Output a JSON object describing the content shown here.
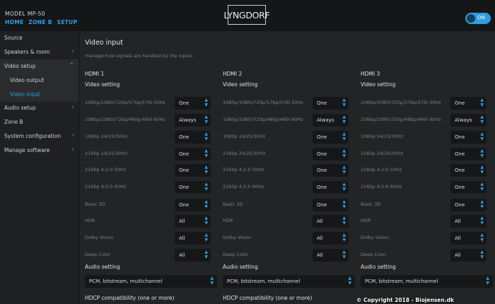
{
  "header": {
    "model": "MODEL MP-50",
    "breadcrumb": [
      "HOME",
      "ZONE B",
      "SETUP"
    ],
    "logo": "LYNGDORF",
    "power_toggle": "ON",
    "accent_color": "#2f9ee0"
  },
  "sidebar": {
    "items": [
      {
        "label": "Source",
        "chevron": false
      },
      {
        "label": "Speakers & room",
        "chevron": true
      },
      {
        "label": "Video setup",
        "chevron": true,
        "open": true
      },
      {
        "label": "Video output",
        "sub": true
      },
      {
        "label": "Video input",
        "sub": true,
        "active": true
      },
      {
        "label": "Audio setup",
        "chevron": true
      },
      {
        "label": "Zone B",
        "chevron": false
      },
      {
        "label": "System configuration",
        "chevron": true
      },
      {
        "label": "Manage software",
        "chevron": true
      }
    ]
  },
  "main": {
    "title": "Video input",
    "description": "manage how signals are handled by the inputs",
    "columns": [
      {
        "heading": "HDMI 1",
        "video_setting_label": "Video setting",
        "rows": [
          {
            "label": "1080p/1080i/720p/576p/576i 50Hz",
            "value": "One"
          },
          {
            "label": "1080p/1080i/720p/480p/480i 60Hz",
            "value": "Always"
          },
          {
            "label": "1080p 24/25/30Hz",
            "value": "One"
          },
          {
            "label": "2160p 24/25/30Hz",
            "value": "One"
          },
          {
            "label": "2160p 4:2:0 50Hz",
            "value": "One"
          },
          {
            "label": "2160p 4:2:0 60Hz",
            "value": "One"
          },
          {
            "label": "Basic 3D",
            "value": "One"
          },
          {
            "label": "HDR",
            "value": "All"
          },
          {
            "label": "Dolby Vision",
            "value": "All"
          },
          {
            "label": "Deep Color",
            "value": "All"
          }
        ],
        "audio_setting_label": "Audio setting",
        "audio_setting_value": "PCM, bitstream, multichannel",
        "hdcp_label": "HDCP compatibility (one or more)"
      },
      {
        "heading": "HDMI 2",
        "video_setting_label": "Video setting",
        "rows": [
          {
            "label": "1080p/1080i/720p/576p/576i 50Hz",
            "value": "One"
          },
          {
            "label": "1080p/1080i/720p/480p/480i 60Hz",
            "value": "Always"
          },
          {
            "label": "1080p 24/25/30Hz",
            "value": "One"
          },
          {
            "label": "2160p 24/25/30Hz",
            "value": "One"
          },
          {
            "label": "2160p 4:2:0 50Hz",
            "value": "One"
          },
          {
            "label": "2160p 4:2:0 60Hz",
            "value": "One"
          },
          {
            "label": "Basic 3D",
            "value": "One"
          },
          {
            "label": "HDR",
            "value": "All"
          },
          {
            "label": "Dolby Vision",
            "value": "All"
          },
          {
            "label": "Deep Color",
            "value": "All"
          }
        ],
        "audio_setting_label": "Audio setting",
        "audio_setting_value": "PCM, bitstream, multichannel",
        "hdcp_label": "HDCP compatibility (one or more)"
      },
      {
        "heading": "HDMI 3",
        "video_setting_label": "Video setting",
        "rows": [
          {
            "label": "1080p/1080i/720p/576p/576i 50Hz",
            "value": "One"
          },
          {
            "label": "1080p/1080i/720p/480p/480i 60Hz",
            "value": "Always"
          },
          {
            "label": "1080p 24/25/30Hz",
            "value": "One"
          },
          {
            "label": "2160p 24/25/30Hz",
            "value": "One"
          },
          {
            "label": "2160p 4:2:0 50Hz",
            "value": "One"
          },
          {
            "label": "2160p 4:2:0 60Hz",
            "value": "One"
          },
          {
            "label": "Basic 3D",
            "value": "One"
          },
          {
            "label": "HDR",
            "value": "All"
          },
          {
            "label": "Dolby Vision",
            "value": "All"
          },
          {
            "label": "Deep Color",
            "value": "All"
          }
        ],
        "audio_setting_label": "Audio setting",
        "audio_setting_value": "PCM, bitstream, multichannel",
        "hdcp_label": ""
      }
    ]
  },
  "watermark": "© Copyright 2018 - Biojensen.dk"
}
